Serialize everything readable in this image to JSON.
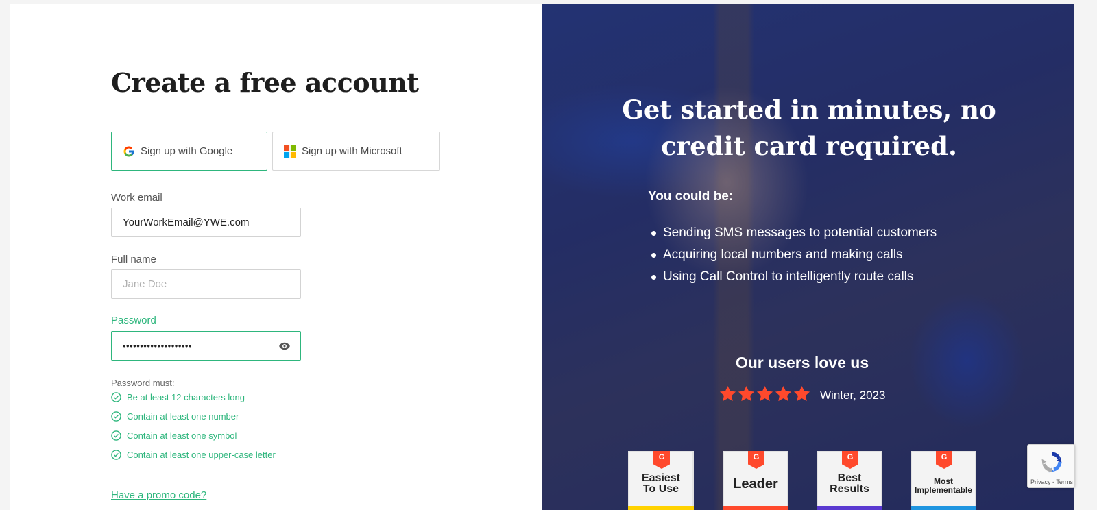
{
  "signup": {
    "title": "Create a free account",
    "google_label": "Sign up with Google",
    "microsoft_label": "Sign up with Microsoft",
    "email_label": "Work email",
    "email_value": "YourWorkEmail@YWE.com",
    "name_label": "Full name",
    "name_placeholder": "Jane Doe",
    "password_label": "Password",
    "password_value": "••••••••••••••••••••",
    "password_rules_heading": "Password must:",
    "password_rules": [
      "Be at least 12 characters long",
      "Contain at least one number",
      "Contain at least one symbol",
      "Contain at least one upper-case letter"
    ],
    "promo_link": "Have a promo code?"
  },
  "promo_panel": {
    "headline": "Get started in minutes, no credit card required.",
    "could_be": "You could be:",
    "bullets": [
      "Sending SMS messages to potential customers",
      "Acquiring local numbers and making calls",
      "Using Call Control to intelligently route calls"
    ],
    "love_heading": "Our users love us",
    "rating_stars": 5,
    "rating_period": "Winter, 2023",
    "badges": [
      {
        "line1": "Easiest",
        "line2": "To Use",
        "band_color": "#ffd200"
      },
      {
        "line1": "Leader",
        "line2": "",
        "band_color": "#ff492c"
      },
      {
        "line1": "Best",
        "line2": "Results",
        "band_color": "#5a39d0"
      },
      {
        "line1": "Most",
        "line2": "Implementable",
        "band_color": "#1f95e0"
      }
    ]
  },
  "recaptcha": {
    "text": "Privacy - Terms"
  },
  "colors": {
    "accent": "#2eb67d",
    "star": "#ff492c"
  }
}
